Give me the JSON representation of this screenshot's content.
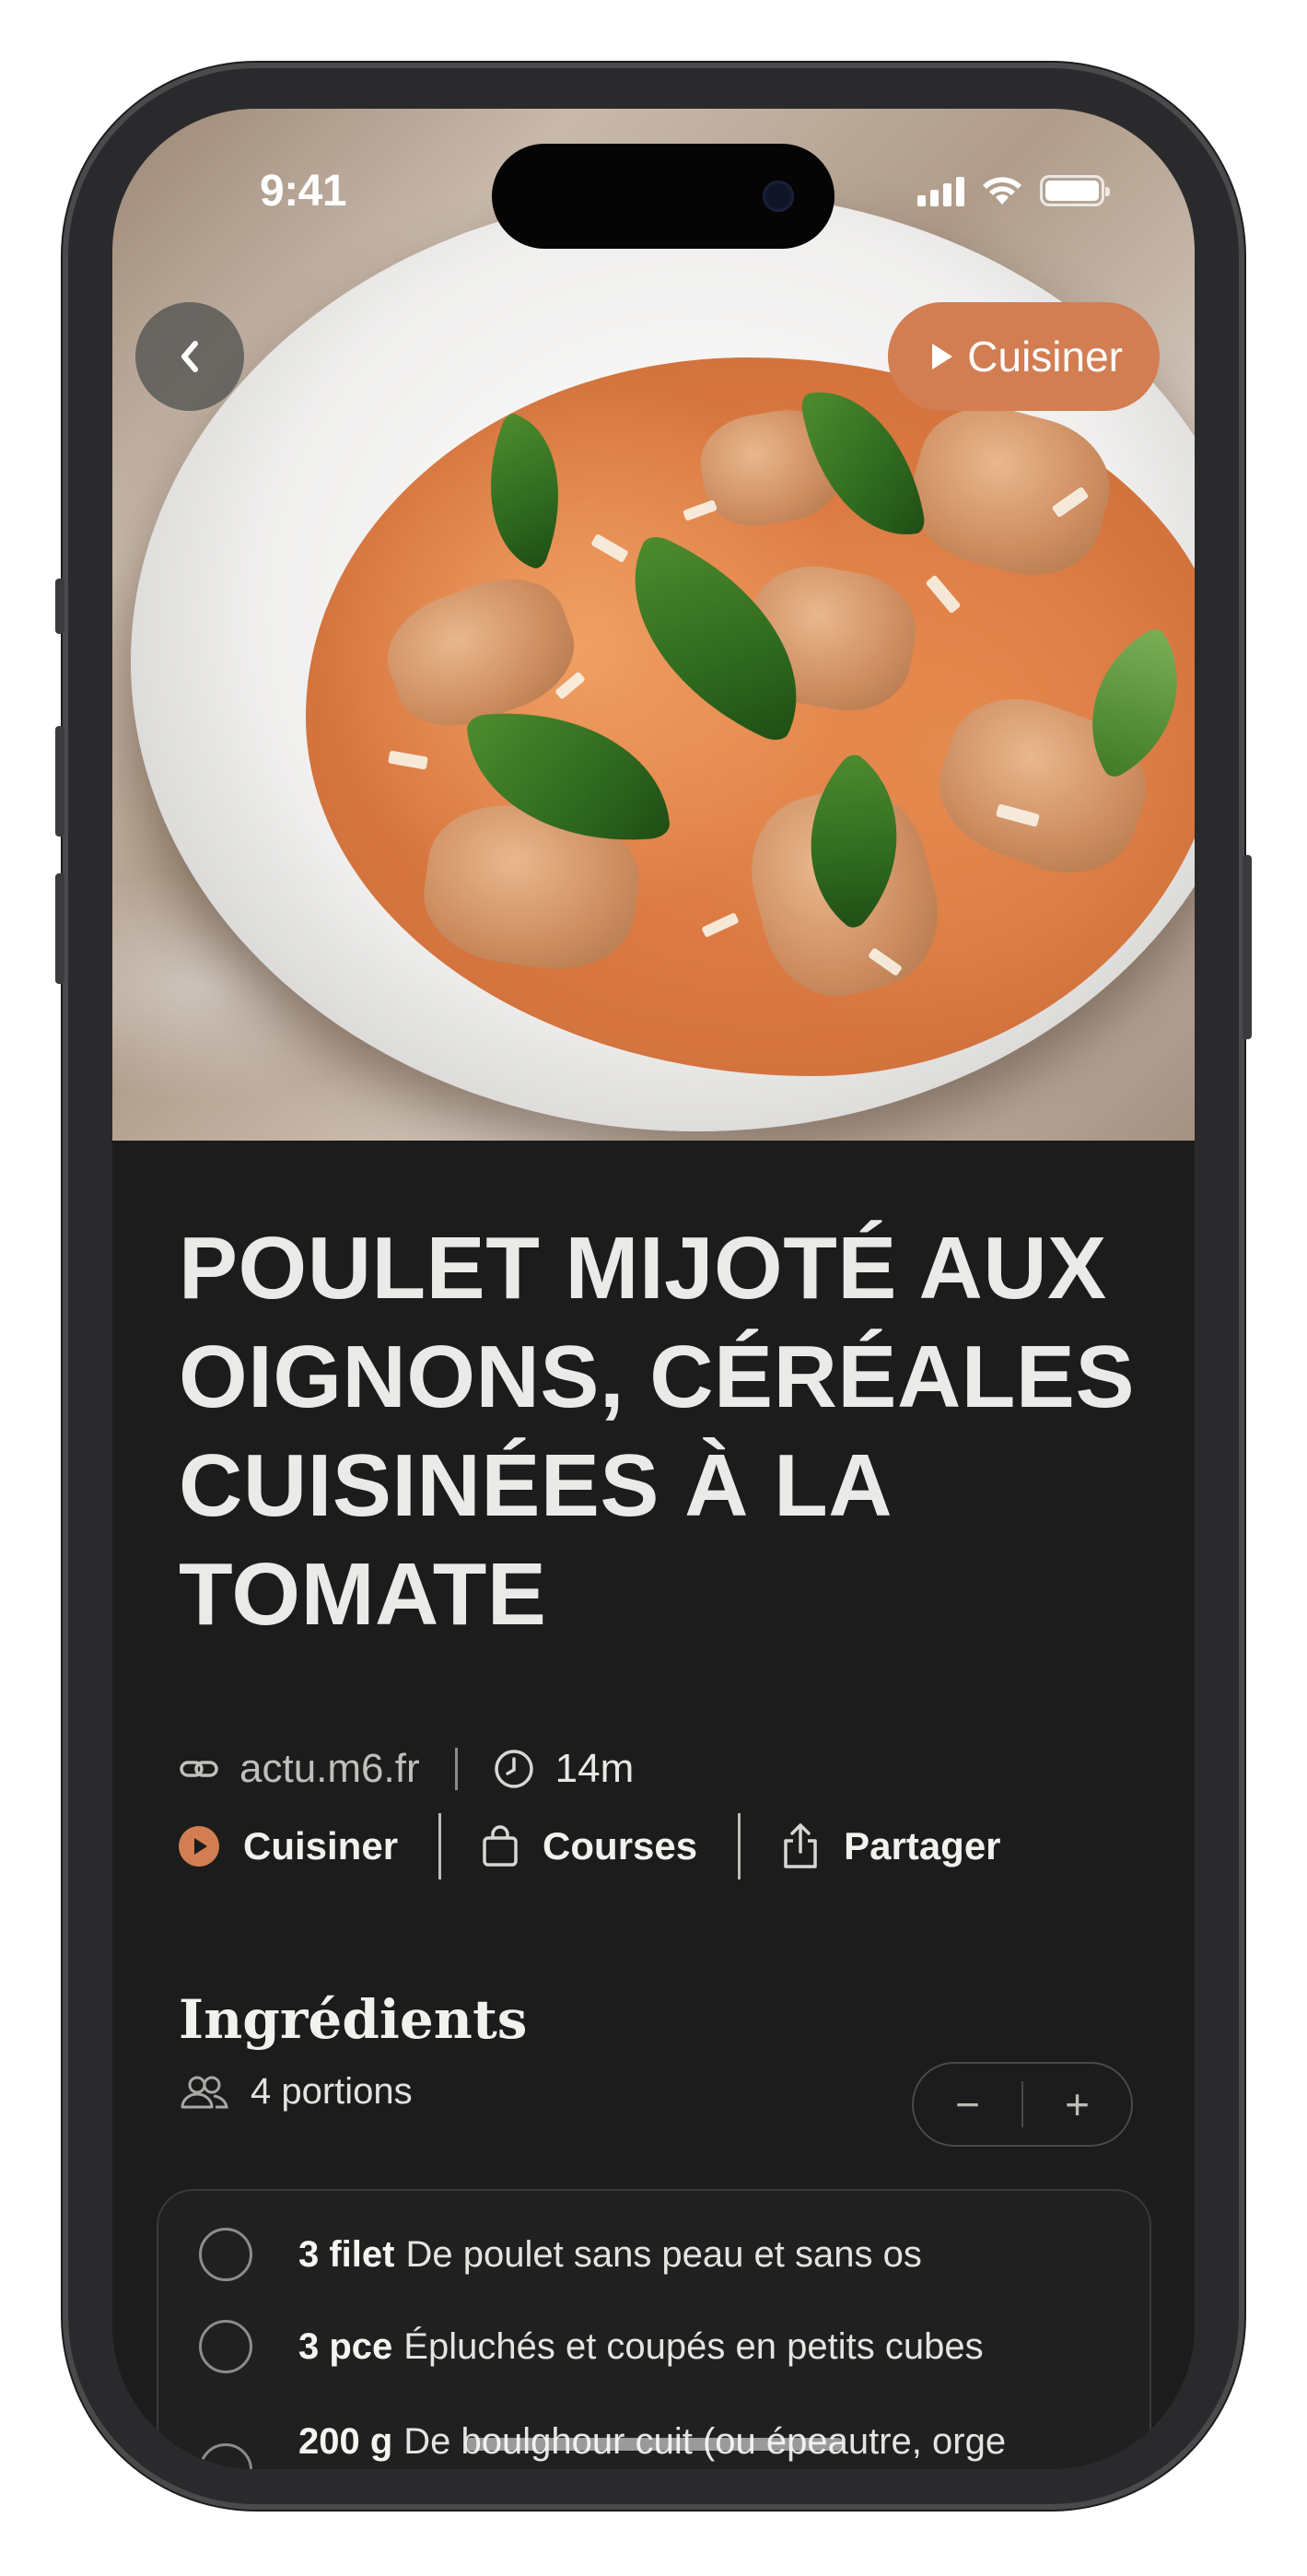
{
  "status_bar": {
    "time": "9:41"
  },
  "hero": {
    "cook_button_label": "Cuisiner"
  },
  "recipe": {
    "title": "POULET MIJOTÉ AUX OIGNONS, CÉRÉALES CUISINÉES À LA TOMATE",
    "source": "actu.m6.fr",
    "duration": "14m"
  },
  "actions": [
    {
      "label": "Cuisiner",
      "icon": "play-circle-icon"
    },
    {
      "label": "Courses",
      "icon": "shopping-bag-icon"
    },
    {
      "label": "Partager",
      "icon": "share-icon"
    }
  ],
  "ingredients": {
    "heading": "Ingrédients",
    "portions": "4 portions",
    "stepper_minus": "−",
    "stepper_plus": "+",
    "items": [
      {
        "qty": "3 filet",
        "text": "De poulet sans peau et sans os"
      },
      {
        "qty": "3 pce",
        "text": "Épluchés et coupés en petits cubes"
      },
      {
        "qty": "200 g",
        "text": "De boulghour cuit (ou épeautre, orge"
      }
    ]
  },
  "colors": {
    "accent": "#d27e52",
    "background": "#1b1c1b",
    "text": "#eaeae8"
  }
}
